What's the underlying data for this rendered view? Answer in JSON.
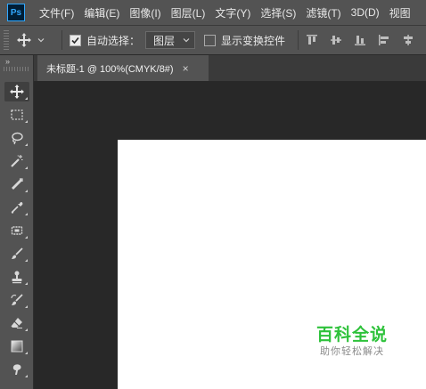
{
  "app": {
    "logo_text": "Ps"
  },
  "menu": [
    {
      "label": "文件(F)"
    },
    {
      "label": "编辑(E)"
    },
    {
      "label": "图像(I)"
    },
    {
      "label": "图层(L)"
    },
    {
      "label": "文字(Y)"
    },
    {
      "label": "选择(S)"
    },
    {
      "label": "滤镜(T)"
    },
    {
      "label": "3D(D)"
    },
    {
      "label": "视图"
    }
  ],
  "options": {
    "auto_select_label": "自动选择：",
    "auto_select_checked": true,
    "auto_select_target": "图层",
    "show_transform_label": "显示变换控件",
    "show_transform_checked": false
  },
  "document_tab": {
    "title": "未标题-1 @ 100%(CMYK/8#)",
    "close": "×"
  },
  "toolbar": {
    "collapse": "»",
    "tools": [
      {
        "name": "move-tool",
        "icon": "move-icon",
        "active": true
      },
      {
        "name": "marquee-tool",
        "icon": "rectangular-marquee-icon"
      },
      {
        "name": "lasso-tool",
        "icon": "lasso-icon"
      },
      {
        "name": "magic-wand-tool",
        "icon": "magic-wand-icon"
      },
      {
        "name": "crop-tool",
        "icon": "crop-icon"
      },
      {
        "name": "eyedropper-tool",
        "icon": "eyedropper-icon"
      },
      {
        "name": "healing-tool",
        "icon": "healing-brush-icon"
      },
      {
        "name": "brush-tool",
        "icon": "brush-icon"
      },
      {
        "name": "stamp-tool",
        "icon": "clone-stamp-icon"
      },
      {
        "name": "history-brush-tool",
        "icon": "history-brush-icon"
      },
      {
        "name": "eraser-tool",
        "icon": "eraser-icon"
      },
      {
        "name": "gradient-tool",
        "icon": "gradient-icon"
      },
      {
        "name": "smudge-tool",
        "icon": "smudge-icon"
      }
    ]
  },
  "watermark": {
    "title": "百科全说",
    "subtitle": "助你轻松解决"
  },
  "colors": {
    "chrome": "#535353",
    "workspace": "#282828",
    "canvas": "#ffffff",
    "accent": "#31a8ff",
    "watermark_green": "#2ec23b"
  }
}
